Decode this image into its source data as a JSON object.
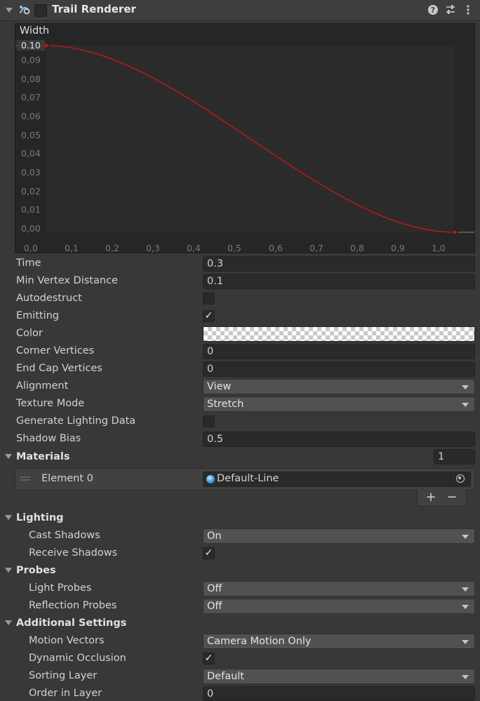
{
  "header": {
    "title": "Trail Renderer",
    "enabled": false
  },
  "curve": {
    "label": "Width",
    "y_ticks": [
      "0.10",
      "0,09",
      "0,08",
      "0,07",
      "0,06",
      "0,05",
      "0,04",
      "0,03",
      "0,02",
      "0,01",
      "0,00"
    ],
    "x_ticks": [
      "0,0",
      "0,1",
      "0,2",
      "0,3",
      "0,4",
      "0,5",
      "0,6",
      "0,7",
      "0,8",
      "0,9",
      "1,0"
    ],
    "line_color": "#b41a1a"
  },
  "properties": {
    "time": {
      "label": "Time",
      "value": "0.3"
    },
    "min_vertex_distance": {
      "label": "Min Vertex Distance",
      "value": "0.1"
    },
    "autodestruct": {
      "label": "Autodestruct",
      "checked": false
    },
    "emitting": {
      "label": "Emitting",
      "checked": true,
      "mark": "✓"
    },
    "color": {
      "label": "Color"
    },
    "corner_vertices": {
      "label": "Corner Vertices",
      "value": "0"
    },
    "end_cap_vertices": {
      "label": "End Cap Vertices",
      "value": "0"
    },
    "alignment": {
      "label": "Alignment",
      "value": "View"
    },
    "texture_mode": {
      "label": "Texture Mode",
      "value": "Stretch"
    },
    "generate_lighting_data": {
      "label": "Generate Lighting Data",
      "checked": false
    },
    "shadow_bias": {
      "label": "Shadow Bias",
      "value": "0.5"
    }
  },
  "materials": {
    "label": "Materials",
    "count": "1",
    "element_label": "Element 0",
    "element_value": "Default-Line",
    "add": "+",
    "remove": "−"
  },
  "lighting": {
    "label": "Lighting",
    "cast_shadows": {
      "label": "Cast Shadows",
      "value": "On"
    },
    "receive_shadows": {
      "label": "Receive Shadows",
      "checked": true,
      "mark": "✓"
    }
  },
  "probes": {
    "label": "Probes",
    "light_probes": {
      "label": "Light Probes",
      "value": "Off"
    },
    "reflection_probes": {
      "label": "Reflection Probes",
      "value": "Off"
    }
  },
  "additional": {
    "label": "Additional Settings",
    "motion_vectors": {
      "label": "Motion Vectors",
      "value": "Camera Motion Only"
    },
    "dynamic_occlusion": {
      "label": "Dynamic Occlusion",
      "checked": true,
      "mark": "✓"
    },
    "sorting_layer": {
      "label": "Sorting Layer",
      "value": "Default"
    },
    "order_in_layer": {
      "label": "Order in Layer",
      "value": "0"
    }
  }
}
